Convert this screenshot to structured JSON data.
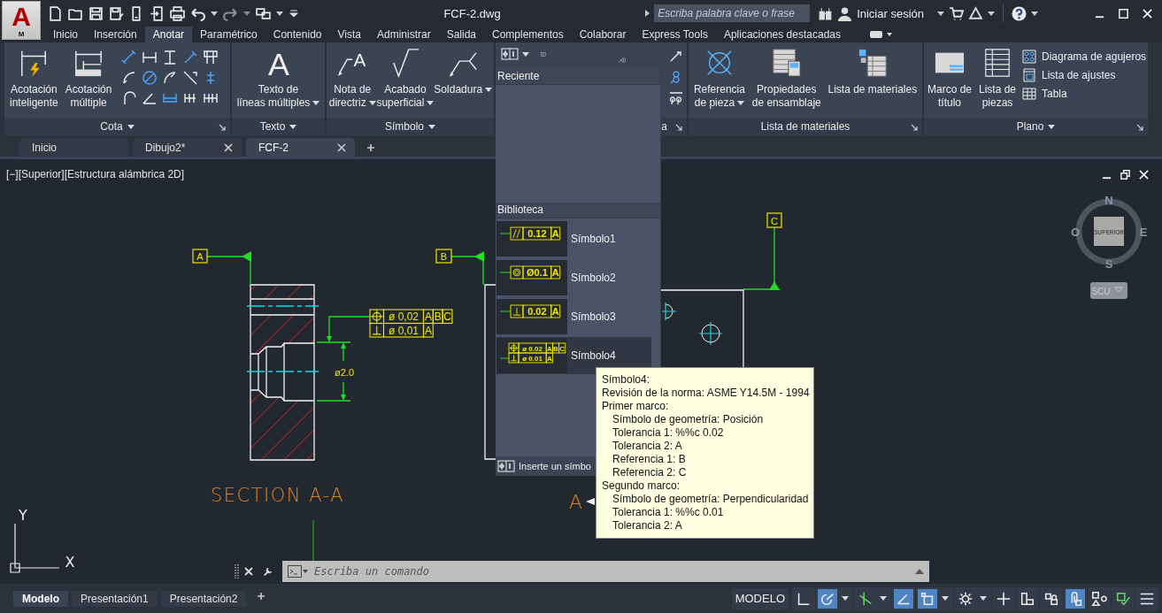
{
  "app": {
    "logo_letter": "A",
    "logo_sub": "M"
  },
  "title_bar": {
    "title": "FCF-2.dwg",
    "search_placeholder": "Escriba palabra clave o frase",
    "sign_in": "Iniciar sesión"
  },
  "ribbon_tabs": [
    {
      "label": "Inicio",
      "selected": false
    },
    {
      "label": "Inserción",
      "selected": false
    },
    {
      "label": "Anotar",
      "selected": true
    },
    {
      "label": "Paramétrico",
      "selected": false
    },
    {
      "label": "Contenido",
      "selected": false
    },
    {
      "label": "Vista",
      "selected": false
    },
    {
      "label": "Administrar",
      "selected": false
    },
    {
      "label": "Salida",
      "selected": false
    },
    {
      "label": "Complementos",
      "selected": false
    },
    {
      "label": "Colaborar",
      "selected": false
    },
    {
      "label": "Express Tools",
      "selected": false
    },
    {
      "label": "Aplicaciones destacadas",
      "selected": false
    }
  ],
  "ribbon_panels": [
    {
      "kind": "dimension",
      "title": "Cota",
      "menu": true,
      "launcher": true,
      "buttons": [
        {
          "kind": "smartdim",
          "label": "Acotación\ninteligente",
          "menu": false
        },
        {
          "kind": "multidim",
          "label": "Acotación\nmúltiple",
          "menu": false
        }
      ]
    },
    {
      "kind": "text",
      "title": "Texto",
      "menu": true,
      "launcher": false,
      "buttons": [
        {
          "kind": "mtext",
          "glyph": "A",
          "label": "Texto de\nlíneas múltiples",
          "menu": true
        }
      ]
    },
    {
      "kind": "symbol",
      "title": "Símbolo",
      "menu": true,
      "launcher": false,
      "buttons": [
        {
          "kind": "leader",
          "glyph": "A",
          "label": "Nota de\ndirectriz",
          "menu": true
        },
        {
          "kind": "surface",
          "label": "Acabado\nsuperficial",
          "menu": true
        },
        {
          "kind": "weld",
          "label": "Soldadura",
          "menu": true
        }
      ]
    },
    {
      "kind": "partial",
      "title": "a",
      "menu": false,
      "launcher": true
    },
    {
      "kind": "bom",
      "title": "Lista de materiales",
      "menu": false,
      "launcher": true,
      "buttons": [
        {
          "kind": "balloon",
          "label": "Referencia\nde pieza",
          "menu": true
        },
        {
          "kind": "assembly",
          "label": "Propiedades\nde ensamblaje",
          "menu": false
        },
        {
          "kind": "bomlist",
          "label": "Lista de materiales",
          "menu": false
        }
      ]
    },
    {
      "kind": "plano",
      "title": "Plano",
      "menu": true,
      "launcher": true,
      "buttons": [
        {
          "kind": "titleblock",
          "label": "Marco de\ntítulo",
          "menu": false
        },
        {
          "kind": "partslist",
          "label": "Lista de\npiezas",
          "menu": false
        }
      ],
      "small": [
        {
          "kind": "holechart",
          "label": "Diagrama de agujeros"
        },
        {
          "kind": "fits",
          "label": "Lista de ajustes"
        },
        {
          "kind": "table",
          "label": "Tabla"
        }
      ]
    }
  ],
  "doc_tabs": [
    {
      "label": "Inicio",
      "selected": false,
      "closable": false
    },
    {
      "label": "Dibujo2*",
      "selected": false,
      "closable": true
    },
    {
      "label": "FCF-2",
      "selected": true,
      "closable": true
    }
  ],
  "viewport": {
    "label": "[−][Superior][Estructura alámbrica 2D]",
    "datums": [
      "A",
      "B",
      "C"
    ],
    "fcf": [
      {
        "kind": "position",
        "tolerance": "ø 0,02",
        "datums": [
          "A",
          "B",
          "C"
        ]
      },
      {
        "kind": "perpendicularity",
        "tolerance": "ø 0,01",
        "datums": [
          "A"
        ]
      }
    ],
    "dimension": "ø2.0",
    "section_label": "SECTION A-A",
    "section_mark": "A",
    "ucs": {
      "x": "X",
      "y": "Y"
    },
    "viewcube": {
      "north": "N",
      "east": "E",
      "south": "S",
      "west": "O",
      "face": "SUPERIOR",
      "ucs_button": "SCU"
    }
  },
  "gallery": {
    "recent_header": "Reciente",
    "library_header": "Biblioteca",
    "footer": "Inserte un símbo",
    "items": [
      {
        "label": "Símbolo1",
        "selected": false,
        "rows": [
          {
            "kind": "parallelism",
            "tolerance": "0.12",
            "datums": [
              "A"
            ]
          }
        ]
      },
      {
        "label": "Símbolo2",
        "selected": false,
        "rows": [
          {
            "kind": "concentricity",
            "tolerance": "Ø0.1",
            "datums": [
              "A"
            ]
          }
        ]
      },
      {
        "label": "Símbolo3",
        "selected": false,
        "rows": [
          {
            "kind": "perpendicularity",
            "tolerance": "0.02",
            "datums": [
              "A"
            ]
          }
        ]
      },
      {
        "label": "Símbolo4",
        "selected": true,
        "rows": [
          {
            "kind": "position",
            "tolerance": "ø 0.02",
            "datums": [
              "A",
              "B",
              "C"
            ]
          },
          {
            "kind": "perpendicularity",
            "tolerance": "ø 0.01",
            "datums": [
              "A"
            ]
          }
        ]
      }
    ]
  },
  "tooltip": [
    {
      "text": "Símbolo4:",
      "indent": false
    },
    {
      "text": "Revisión de la norma: ASME Y14.5M - 1994",
      "indent": false
    },
    {
      "text": "Primer marco:",
      "indent": false
    },
    {
      "text": "Símbolo de geometría: Posición",
      "indent": true
    },
    {
      "text": "Tolerancia 1: %%c 0.02",
      "indent": true
    },
    {
      "text": "Tolerancia 2: A",
      "indent": true
    },
    {
      "text": "Referencia 1: B",
      "indent": true
    },
    {
      "text": "Referencia 2: C",
      "indent": true
    },
    {
      "text": "Segundo marco:",
      "indent": false
    },
    {
      "text": "Símbolo de geometría: Perpendicularidad",
      "indent": true
    },
    {
      "text": "Tolerancia 1: %%c 0.01",
      "indent": true
    },
    {
      "text": "Tolerancia 2: A",
      "indent": true
    }
  ],
  "command_line": {
    "placeholder": "Escriba un comando"
  },
  "layout_tabs": [
    {
      "label": "Modelo",
      "selected": true
    },
    {
      "label": "Presentación1",
      "selected": false
    },
    {
      "label": "Presentación2",
      "selected": false
    }
  ],
  "status_bar": {
    "model_button": "MODELO",
    "tools": [
      {
        "kind": "corner",
        "on": false,
        "menu": false
      },
      {
        "kind": "polar",
        "on": true,
        "menu": true
      },
      {
        "kind": "iso",
        "on": false,
        "menu": true
      },
      {
        "kind": "angle",
        "on": true,
        "menu": false
      },
      {
        "kind": "square",
        "on": true,
        "menu": true
      },
      {
        "kind": "gear",
        "on": false,
        "menu": true
      },
      {
        "kind": "plus",
        "on": false,
        "menu": false
      },
      {
        "kind": "blocks",
        "on": false,
        "menu": false
      },
      {
        "kind": "lock",
        "on": false,
        "menu": false
      },
      {
        "kind": "clip",
        "on": true,
        "menu": false
      },
      {
        "kind": "shapes",
        "on": false,
        "menu": false
      },
      {
        "kind": "check",
        "on": false,
        "menu": false
      },
      {
        "kind": "menu",
        "on": false,
        "menu": false
      }
    ]
  }
}
